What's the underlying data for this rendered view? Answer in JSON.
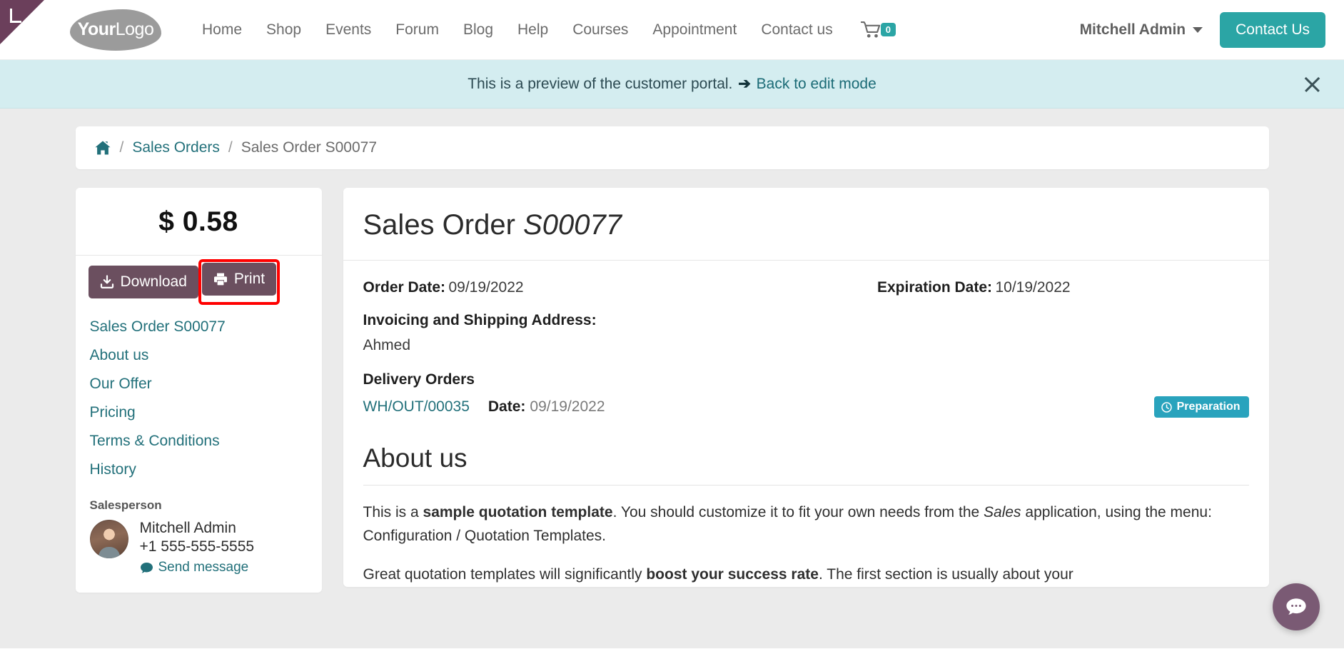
{
  "navbar": {
    "logo": {
      "bold": "Your",
      "light": "Logo"
    },
    "links": [
      {
        "label": "Home"
      },
      {
        "label": "Shop"
      },
      {
        "label": "Events"
      },
      {
        "label": "Forum"
      },
      {
        "label": "Blog"
      },
      {
        "label": "Help"
      },
      {
        "label": "Courses"
      },
      {
        "label": "Appointment"
      },
      {
        "label": "Contact us"
      }
    ],
    "cart": {
      "icon": "shopping-cart-icon",
      "count": "0"
    },
    "user": {
      "name": "Mitchell Admin",
      "icon": "chevron-down-icon"
    },
    "contact_button": "Contact Us",
    "accent_color": "#2ba5a5"
  },
  "banner": {
    "text": "This is a preview of the customer portal.",
    "arrow": "➔",
    "link": "Back to edit mode",
    "close_icon": "close-icon",
    "background": "#d4edf0"
  },
  "breadcrumb": {
    "home_icon": "home-icon",
    "sep": "/",
    "items": [
      {
        "label": "Sales Orders",
        "current": false
      },
      {
        "label": "Sales Order S00077",
        "current": true
      }
    ]
  },
  "sidebar": {
    "amount": "$ 0.58",
    "buttons": [
      {
        "label": "Download",
        "icon": "download-icon"
      },
      {
        "label": "Print",
        "icon": "printer-icon",
        "highlighted": true
      }
    ],
    "links": [
      {
        "label": "Sales Order S00077"
      },
      {
        "label": "About us"
      },
      {
        "label": "Our Offer"
      },
      {
        "label": "Pricing"
      },
      {
        "label": "Terms & Conditions"
      },
      {
        "label": "History"
      }
    ],
    "salesperson": {
      "title": "Salesperson",
      "avatar": "avatar",
      "name": "Mitchell Admin",
      "phone": "+1 555-555-5555",
      "message_link": "Send message",
      "message_icon": "comment-icon"
    }
  },
  "main": {
    "title_prefix": "Sales Order ",
    "title_ref": "S00077",
    "order_date_label": "Order Date:",
    "order_date_value": "09/19/2022",
    "expiration_date_label": "Expiration Date:",
    "expiration_date_value": "10/19/2022",
    "address_label": "Invoicing and Shipping Address:",
    "address_value": "Ahmed",
    "delivery_label": "Delivery Orders",
    "delivery_ref": "WH/OUT/00035",
    "delivery_date_label": "Date:",
    "delivery_date_value": "09/19/2022",
    "status_badge": "Preparation",
    "status_icon": "clock-icon",
    "status_color": "#29a3bd",
    "about_heading": "About us",
    "about_p1_a": "This is a ",
    "about_p1_b": "sample quotation template",
    "about_p1_c": ". You should customize it to fit your own needs from the ",
    "about_p1_d": "Sales",
    "about_p1_e": " application, using the menu: Configuration / Quotation Templates.",
    "about_p2_a": "Great quotation templates will significantly ",
    "about_p2_b": "boost your success rate",
    "about_p2_c": ". The first section is usually about your"
  },
  "chat": {
    "icon": "chat-bubble-icon"
  }
}
